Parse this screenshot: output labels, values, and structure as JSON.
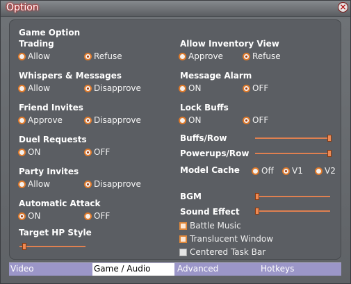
{
  "window": {
    "title": "Option",
    "close_symbol": "×"
  },
  "game_option": {
    "heading": "Game Option"
  },
  "left": {
    "trading": {
      "label": "Trading",
      "options": [
        "Allow",
        "Refuse"
      ],
      "selected": "Refuse"
    },
    "whispers": {
      "label": "Whispers & Messages",
      "options": [
        "Allow",
        "Disapprove"
      ],
      "selected": "Disapprove"
    },
    "friend_invites": {
      "label": "Friend Invites",
      "options": [
        "Approve",
        "Disapprove"
      ],
      "selected": "Disapprove"
    },
    "duel_requests": {
      "label": "Duel Requests",
      "options": [
        "ON",
        "OFF"
      ],
      "selected": "OFF"
    },
    "party_invites": {
      "label": "Party Invites",
      "options": [
        "Allow",
        "Disapprove"
      ],
      "selected": "Disapprove"
    },
    "automatic_attack": {
      "label": "Automatic Attack",
      "options": [
        "ON",
        "OFF"
      ],
      "selected": "ON"
    },
    "target_hp_style": {
      "label": "Target HP Style",
      "value": 0.05
    }
  },
  "right": {
    "inventory_view": {
      "label": "Allow Inventory View",
      "options": [
        "Approve",
        "Refuse"
      ],
      "selected": "Refuse"
    },
    "message_alarm": {
      "label": "Message Alarm",
      "options": [
        "ON",
        "OFF"
      ],
      "selected": "OFF"
    },
    "lock_buffs": {
      "label": "Lock Buffs",
      "options": [
        "ON",
        "OFF"
      ],
      "selected": "OFF"
    },
    "buffs_row": {
      "label": "Buffs/Row",
      "value": 1.0
    },
    "powerups_row": {
      "label": "Powerups/Row",
      "value": 1.0
    },
    "model_cache": {
      "label": "Model Cache",
      "options": [
        "Off",
        "V1",
        "V2"
      ],
      "selected": "V1"
    },
    "bgm": {
      "label": "BGM",
      "value": 0.0
    },
    "sound_effect": {
      "label": "Sound Effect",
      "value": 0.0
    },
    "battle_music": {
      "label": "Battle Music",
      "checked": false
    },
    "translucent_window": {
      "label": "Translucent Window",
      "checked": false
    },
    "centered_task_bar": {
      "label": "Centered Task Bar",
      "checked": false
    }
  },
  "tabs": [
    "Video",
    "Game / Audio",
    "Advanced",
    "Hotkeys"
  ],
  "active_tab": "Game / Audio"
}
